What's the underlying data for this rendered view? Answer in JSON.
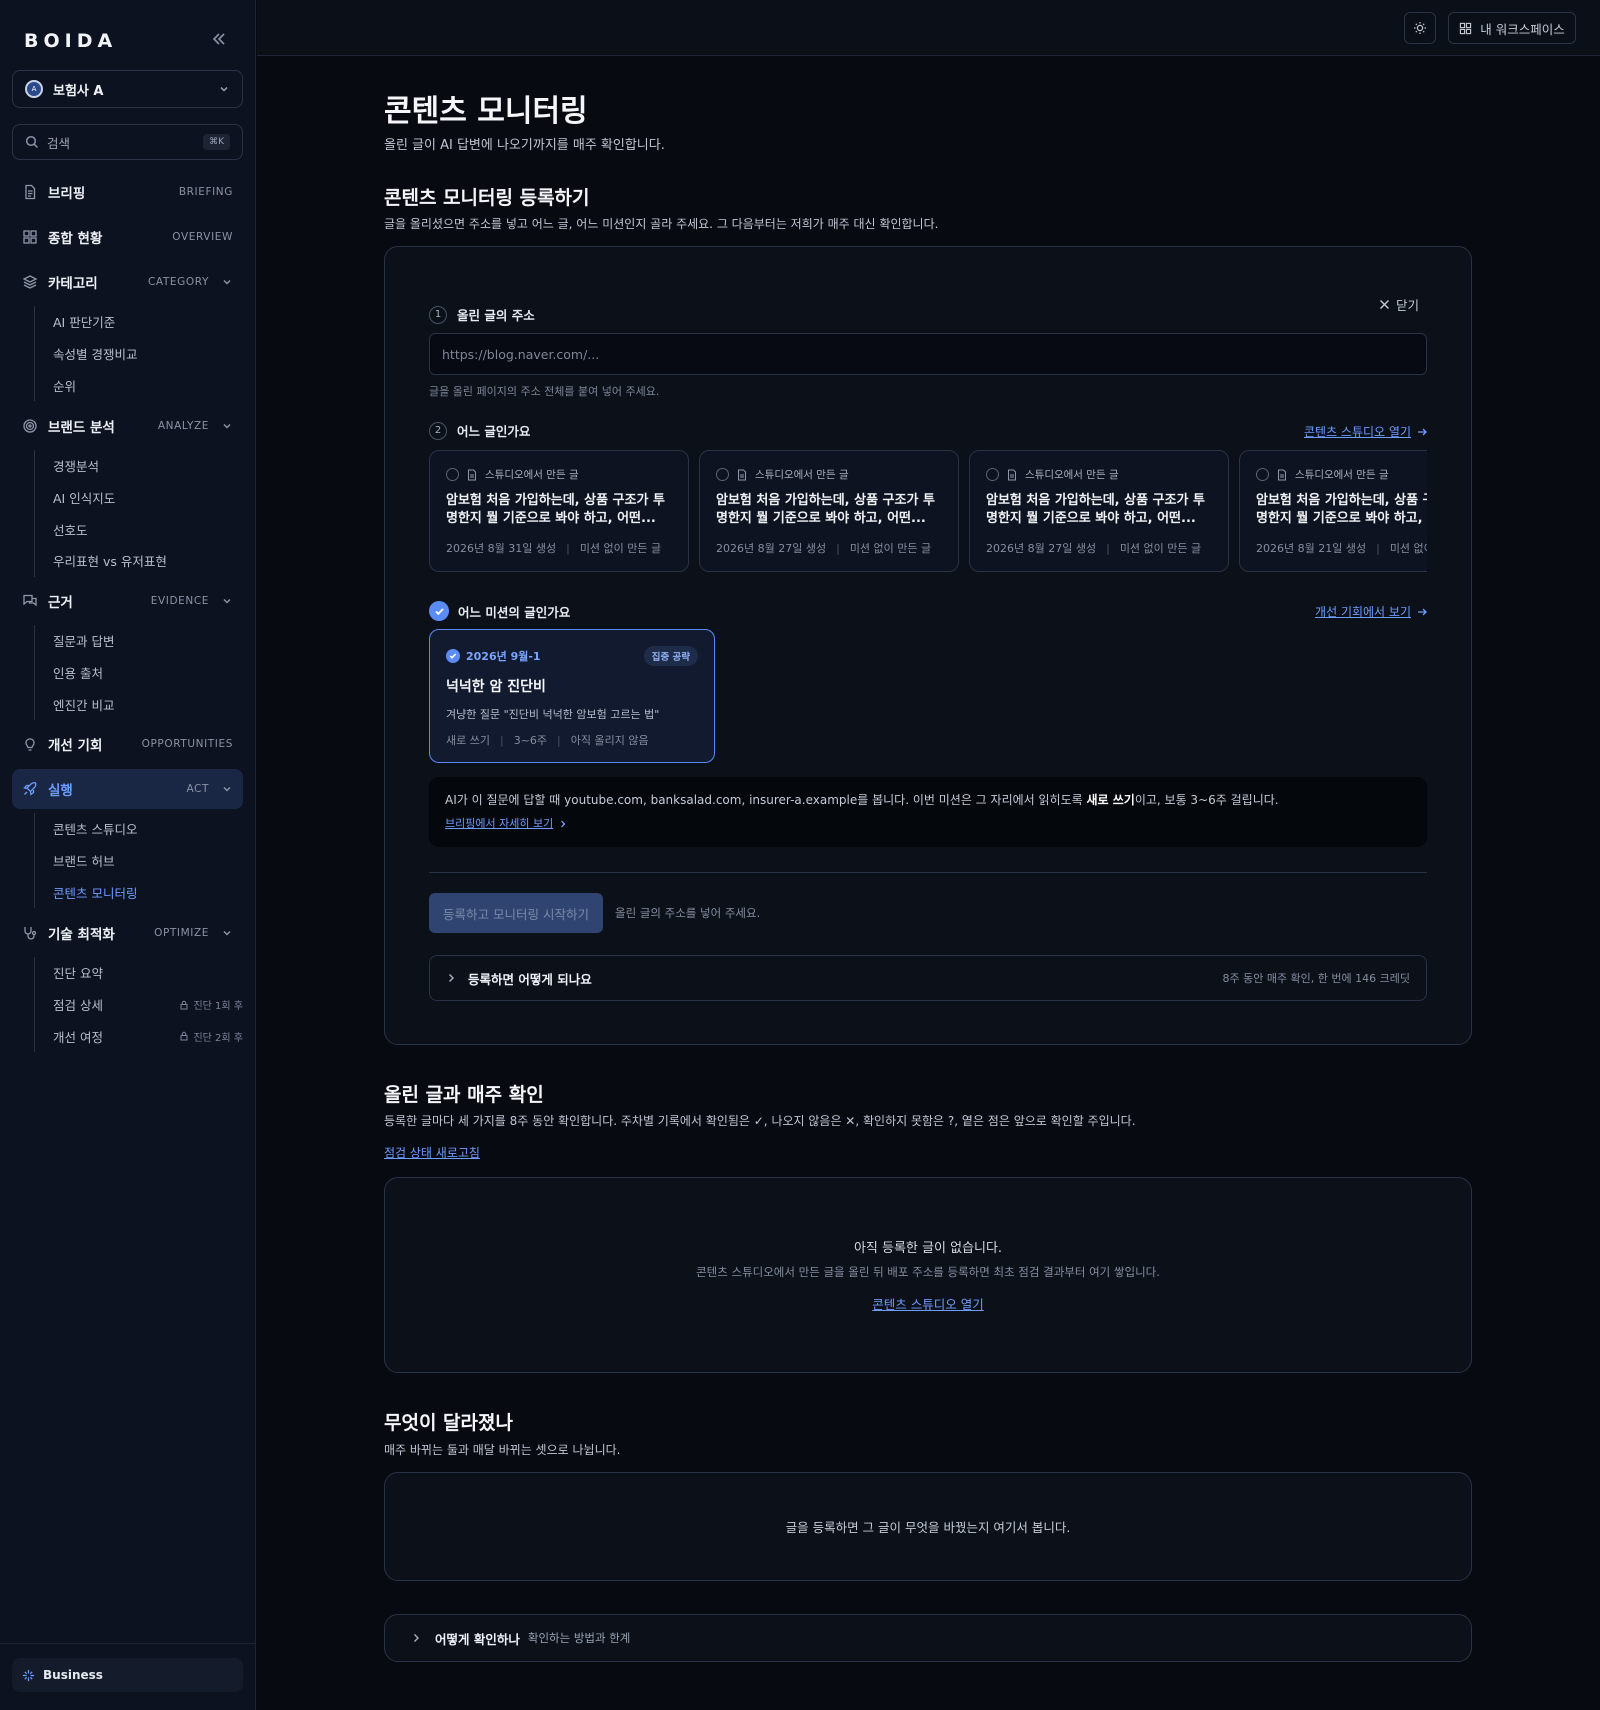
{
  "sidebar": {
    "logo": "BOIDA",
    "workspace": {
      "avatar": "A",
      "name": "보험사 A"
    },
    "search": {
      "placeholder": "검색",
      "shortcut": "⌘K"
    },
    "nav": [
      {
        "label": "브리핑",
        "en": "BRIEFING",
        "icon": "file-text-icon"
      },
      {
        "label": "종합 현황",
        "en": "OVERVIEW",
        "icon": "grid-icon"
      },
      {
        "label": "카테고리",
        "en": "CATEGORY",
        "icon": "layers-icon",
        "items": [
          "AI 판단기준",
          "속성별 경쟁비교",
          "순위"
        ]
      },
      {
        "label": "브랜드 분석",
        "en": "ANALYZE",
        "icon": "target-icon",
        "items": [
          "경쟁분석",
          "AI 인식지도",
          "선호도",
          "우리표현 vs 유저표현"
        ]
      },
      {
        "label": "근거",
        "en": "EVIDENCE",
        "icon": "chat-icon",
        "items": [
          "질문과 답변",
          "인용 출처",
          "엔진간 비교"
        ]
      },
      {
        "label": "개선 기회",
        "en": "OPPORTUNITIES",
        "icon": "lightbulb-icon"
      },
      {
        "label": "실행",
        "en": "ACT",
        "icon": "rocket-icon",
        "items": [
          "콘텐츠 스튜디오",
          "브랜드 허브",
          "콘텐츠 모니터링"
        ]
      },
      {
        "label": "기술 최적화",
        "en": "OPTIMIZE",
        "icon": "stethoscope-icon",
        "items": [
          "진단 요약",
          "점검 상세",
          "개선 여정"
        ],
        "locks": [
          "",
          "진단 1회 후",
          "진단 2회 후"
        ]
      }
    ],
    "plan": "Business"
  },
  "topbar": {
    "workspace_button": "내 워크스페이스"
  },
  "page": {
    "title": "콘텐츠 모니터링",
    "subtitle": "올린 글이 AI 답변에 나오기까지를 매주 확인합니다."
  },
  "register": {
    "title": "콘텐츠 모니터링 등록하기",
    "desc": "글을 올리셨으면 주소를 넣고 어느 글, 어느 미션인지 골라 주세요. 그 다음부터는 저희가 매주 대신 확인합니다.",
    "close": "닫기",
    "step1": {
      "num": "1",
      "label": "올린 글의 주소",
      "placeholder": "https://blog.naver.com/...",
      "hint": "글을 올린 페이지의 주소 전체를 붙여 넣어 주세요."
    },
    "step2": {
      "num": "2",
      "label": "어느 글인가요",
      "link": "콘텐츠 스튜디오 열기"
    },
    "posts": [
      {
        "source": "스튜디오에서 만든 글",
        "title": "암보험 처음 가입하는데, 상품 구조가 투명한지 뭘 기준으로 봐야 하고, 어떤...",
        "date": "2026년 8월 31일 생성",
        "note": "미션 없이 만든 글"
      },
      {
        "source": "스튜디오에서 만든 글",
        "title": "암보험 처음 가입하는데, 상품 구조가 투명한지 뭘 기준으로 봐야 하고, 어떤...",
        "date": "2026년 8월 27일 생성",
        "note": "미션 없이 만든 글"
      },
      {
        "source": "스튜디오에서 만든 글",
        "title": "암보험 처음 가입하는데, 상품 구조가 투명한지 뭘 기준으로 봐야 하고, 어떤...",
        "date": "2026년 8월 27일 생성",
        "note": "미션 없이 만든 글"
      },
      {
        "source": "스튜디오에서 만든 글",
        "title": "암보험 처음 가입하는데, 상품 구조가 투명한지 뭘 기준으로 봐야 하고,",
        "date": "2026년 8월 21일 생성",
        "note": "미션 없이"
      }
    ],
    "step3": {
      "label": "어느 미션의 글인가요",
      "link": "개선 기회에서 보기"
    },
    "mission": {
      "code": "2026년 9월-1",
      "badge": "집중 공략",
      "title": "넉넉한 암 진단비",
      "question": "겨냥한 질문 \"진단비 넉넉한 암보험 고르는 법\"",
      "m1": "새로 쓰기",
      "m2": "3~6주",
      "m3": "아직 올리지 않음"
    },
    "info": {
      "pre": "AI가 이 질문에 답할 때 youtube.com, banksalad.com, insurer-a.example를 봅니다. 이번 미션은 그 자리에서 읽히도록 ",
      "bold": "새로 쓰기",
      "post": "이고, 보통 3~6주 걸립니다.",
      "link": "브리핑에서 자세히 보기"
    },
    "submit": "등록하고 모니터링 시작하기",
    "submit_hint": "올린 글의 주소를 넣어 주세요.",
    "accordion": {
      "title": "등록하면 어떻게 되나요",
      "right": "8주 동안 매주 확인, 한 번에 146 크레딧"
    }
  },
  "weekly": {
    "title": "올린 글과 매주 확인",
    "desc": "등록한 글마다 세 가지를 8주 동안 확인합니다. 주차별 기록에서 확인됨은 ✓, 나오지 않음은 ✕, 확인하지 못함은 ?, 옅은 점은 앞으로 확인할 주입니다.",
    "refresh": "점검 상태 새로고침",
    "empty_title": "아직 등록한 글이 없습니다.",
    "empty_desc": "콘텐츠 스튜디오에서 만든 글을 올린 뒤 배포 주소를 등록하면 최초 점검 결과부터 여기 쌓입니다.",
    "empty_link": "콘텐츠 스튜디오 열기"
  },
  "changes": {
    "title": "무엇이 달라졌나",
    "desc": "매주 바뀌는 둘과 매달 바뀌는 셋으로 나뉩니다.",
    "empty": "글을 등록하면 그 글이 무엇을 바꿨는지 여기서 봅니다."
  },
  "how": {
    "title": "어떻게 확인하나",
    "sub": "확인하는 방법과 한계"
  }
}
